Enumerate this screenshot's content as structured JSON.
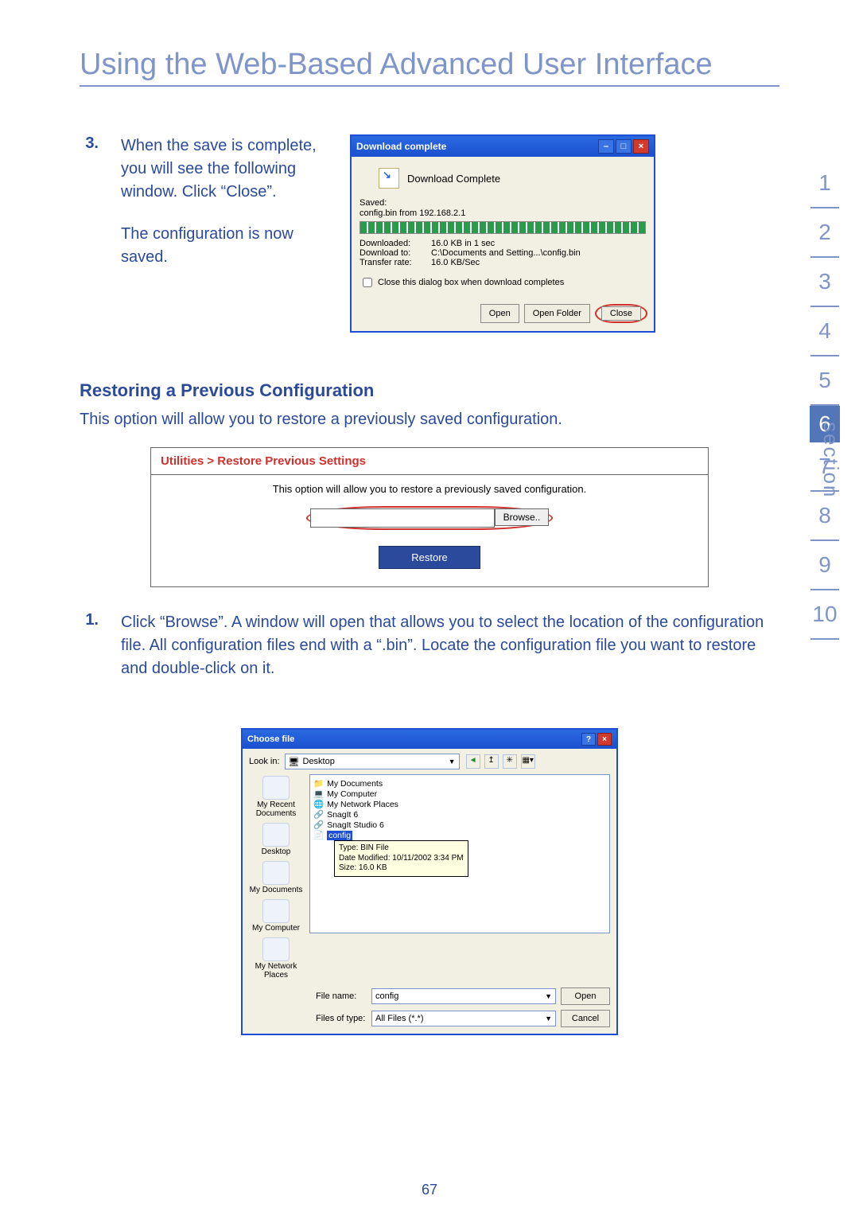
{
  "pageTitle": "Using the Web-Based Advanced User Interface",
  "pageNumber": "67",
  "step3": {
    "num": "3.",
    "text1": "When the save is complete, you will see the following window. Click “Close”.",
    "text2": "The configuration is now saved."
  },
  "download": {
    "title": "Download complete",
    "headline": "Download Complete",
    "savedLabel": "Saved:",
    "savedFile": "config.bin from 192.168.2.1",
    "stats": {
      "downloadedLabel": "Downloaded:",
      "downloadedVal": "16.0 KB in 1 sec",
      "downloadToLabel": "Download to:",
      "downloadToVal": "C:\\Documents and Setting...\\config.bin",
      "rateLabel": "Transfer rate:",
      "rateVal": "16.0 KB/Sec"
    },
    "checkbox": "Close this dialog box when download completes",
    "buttons": {
      "open": "Open",
      "openFolder": "Open Folder",
      "close": "Close"
    }
  },
  "subhead": "Restoring a Previous Configuration",
  "subDesc": "This option will allow you to restore a previously saved configuration.",
  "util": {
    "breadcrumb": "Utilities > Restore Previous Settings",
    "help": "This option will allow you to restore a previously saved configuration.",
    "browse": "Browse..",
    "restore": "Restore"
  },
  "step1": {
    "num": "1.",
    "text": "Click “Browse”. A window will open that allows you to select the location of the configuration file. All configuration files end with a “.bin”. Locate the configuration file you want to restore and double-click on it."
  },
  "choose": {
    "title": "Choose file",
    "lookIn": "Look in:",
    "folder": "Desktop",
    "places": [
      "My Recent Documents",
      "Desktop",
      "My Documents",
      "My Computer",
      "My Network Places"
    ],
    "items": [
      "My Documents",
      "My Computer",
      "My Network Places",
      "SnagIt 6",
      "SnagIt Studio 6",
      "config"
    ],
    "tooltip": {
      "l1": "Type: BIN File",
      "l2": "Date Modified: 10/11/2002 3:34 PM",
      "l3": "Size: 16.0 KB"
    },
    "fileNameLabel": "File name:",
    "fileName": "config",
    "fileTypeLabel": "Files of type:",
    "fileType": "All Files (*.*)",
    "open": "Open",
    "cancel": "Cancel"
  },
  "sections": [
    "1",
    "2",
    "3",
    "4",
    "5",
    "6",
    "7",
    "8",
    "9",
    "10"
  ],
  "sectionWord": "section",
  "currentSection": "6"
}
